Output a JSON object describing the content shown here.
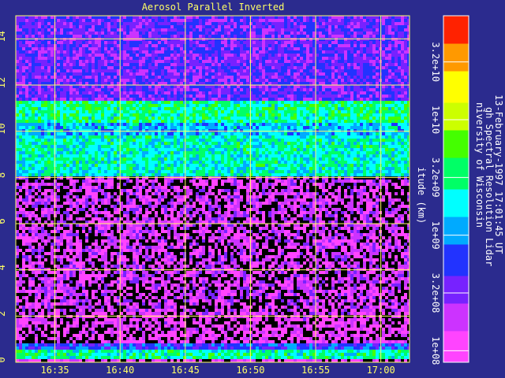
{
  "chart_data": {
    "type": "heatmap",
    "title": "Aerosol Parallel Inverted",
    "ylabel": "itude (km)",
    "x_ticks": [
      "16:35",
      "16:40",
      "16:45",
      "16:50",
      "16:55",
      "17:00"
    ],
    "x_tick_minutes": [
      35,
      40,
      45,
      50,
      55,
      60
    ],
    "xlim_minutes": [
      32,
      62.2
    ],
    "y_ticks": [
      "0",
      "2",
      "4",
      "6",
      "8",
      "10",
      "12",
      "14"
    ],
    "y_tick_values": [
      0,
      2,
      4,
      6,
      8,
      10,
      12,
      14
    ],
    "ylim": [
      0,
      15
    ],
    "grid": true,
    "colorbar": {
      "tick_labels": [
        "1e+08",
        "3.2e+08",
        "1e+09",
        "3.2e+09",
        "1e+10",
        "3.2e+10"
      ],
      "tick_values": [
        8.0,
        8.5,
        9.0,
        9.5,
        10.0,
        10.5
      ],
      "log_range": [
        7.9,
        10.9
      ],
      "colors": [
        "#ff44ff",
        "#cc33ff",
        "#7722ff",
        "#2233ff",
        "#00aaff",
        "#00ffff",
        "#00ff66",
        "#44ff00",
        "#ccff00",
        "#ffff00",
        "#ff9900",
        "#ff2200"
      ]
    },
    "layers": [
      {
        "alt_range": [
          0.0,
          0.15
        ],
        "level": 0.05
      },
      {
        "alt_range": [
          0.15,
          0.5
        ],
        "level": 0.5
      },
      {
        "alt_range": [
          0.5,
          0.8
        ],
        "level": 0.3
      },
      {
        "alt_range": [
          0.8,
          2.0
        ],
        "level": 0.06
      },
      {
        "alt_range": [
          2.0,
          8.0
        ],
        "level": 0.1
      },
      {
        "alt_range": [
          8.0,
          9.8
        ],
        "level": 0.48
      },
      {
        "alt_range": [
          9.8,
          10.3
        ],
        "level": 0.4
      },
      {
        "alt_range": [
          10.3,
          11.3
        ],
        "level": 0.52
      },
      {
        "alt_range": [
          11.3,
          15.0
        ],
        "level": 0.22
      }
    ]
  },
  "side_text": {
    "line1": "niversity of Wisconsin",
    "line2": "gh Spectral Resolution Lidar",
    "line3": "13-February-1997 17:01:45 UT"
  }
}
